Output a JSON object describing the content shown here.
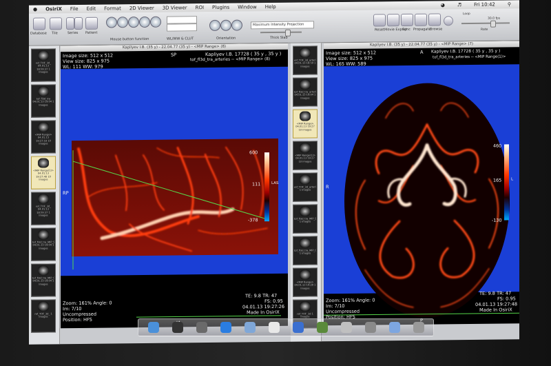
{
  "menubar": {
    "app": "OsiriX",
    "items": [
      "File",
      "Edit",
      "Format",
      "2D Viewer",
      "3D Viewer",
      "ROI",
      "Plugins",
      "Window",
      "Help"
    ],
    "clock": "Fri 10:42"
  },
  "toolbar": {
    "left_labels": [
      "Database",
      "Tile",
      "Series",
      "Patient",
      "Mouse button function",
      "WL/WW & CLUT",
      "Orientation",
      "Thick Slab"
    ],
    "right_labels": [
      "Reset",
      "Movie Export",
      "Sync",
      "Propagate",
      "Browse"
    ],
    "mode_text": "Maximum Intensity Projection",
    "loop_label": "Loop",
    "rate_label": "Rate",
    "fps": "30.0 fps"
  },
  "left_viewer": {
    "title": "Kapliyev I.B. (35 y) - 22.04.77 (35 y) - <MIP Range> (8)",
    "image_size": "Image size: 512 x 512",
    "view_size": "View size: 825 x 975",
    "wl_ww": "WL: 111 WW: 979",
    "orient_top": "SP",
    "orient_left": "RP",
    "orient_bottom": "IA",
    "patient": "Kapliyev I.B. 17728 ( 35 y , 35 y )",
    "protocol": "tof_fl3d_tra_arteries -- <MIP Range> (8)",
    "cb_max": "600",
    "cb_mid": "111",
    "cb_min": "-378",
    "cb_side": "LAS",
    "zoom": "Zoom: 161% Angle: 0",
    "im": "Im: 7/10",
    "compression": "Uncompressed",
    "position": "Position: HFS",
    "te_tr": "TE: 9.8 TR: 47",
    "fs": "FS: 0.95",
    "date": "04.01.13 19:27:26",
    "made_in": "Made In OsiriX"
  },
  "right_viewer": {
    "title": "Kapliyev I.B. (35 y) - 22.04.77 (35 y) - <MIP Range> (7)",
    "image_size": "Image size: 512 x 512",
    "view_size": "View size: 825 x 975",
    "wl_ww": "WL: 165 WW: 589",
    "orient_top": "A",
    "orient_left": "R",
    "orient_bottom": "P",
    "patient": "Kapliyev I.B. 17728 ( 35 y , 35 y )",
    "protocol": "tof_fl3d_tra_arteries -- <MIP Range(1)>",
    "cb_max": "460",
    "cb_mid": "165",
    "cb_min": "-130",
    "cb_side": "L",
    "zoom": "Zoom: 161% Angle: 0",
    "im": "Im: 7/10",
    "compression": "Uncompressed",
    "position": "Position: HFS",
    "te_tr": "TE: 9.8 TR: 47",
    "fs": "FS: 0.95",
    "date": "04.01.13 19:27:48",
    "made_in": "Made In OsiriX"
  },
  "left_series": [
    {
      "caption": "ref_TOF_3d_ 04.01.13 18:59:37 1 Images",
      "selected": false
    },
    {
      "caption": "tof_fl3d_tra 04.01.13 19:04 1 Images",
      "selected": false
    },
    {
      "caption": "<MIP Range> 04.01.13 19:27:18 10 Images",
      "selected": false
    },
    {
      "caption": "<MIP Range(1)> 04.01.13 19:27:48 10 Images",
      "selected": true
    },
    {
      "caption": "ref_TOF_3d_ 04.01.13 18:59:37 1 Images",
      "selected": false
    },
    {
      "caption": "tof_fl3d_tra_MIP_SAG 04.01.13 19:04 1 Images",
      "selected": false
    },
    {
      "caption": "tof_fl3d_tra_MIP_COR 04.01.13 19:04 1 Images",
      "selected": false
    },
    {
      "caption": "ref_TOF_3d_ 1 Images",
      "selected": false
    }
  ],
  "mid_series": [
    {
      "caption": "ref_TOF_3d_arteries 04.01.13 18:59 1 Images",
      "selected": false
    },
    {
      "caption": "tof_fl3d_tra_arteries 04.01.13 19:04 1 Images",
      "selected": false
    },
    {
      "caption": "<MIP Range> 04.01.13 19:27 10 Images",
      "selected": true
    },
    {
      "caption": "<MIP Range(1)> 04.01.13 19:27 10 Images",
      "selected": false
    },
    {
      "caption": "ref_TOF_3d_arteries 1 Images",
      "selected": false
    },
    {
      "caption": "tof_fl3d_tra_MIP_SAG 1 Images",
      "selected": false
    },
    {
      "caption": "tof_fl3d_tra_MIP_COR 1 Images",
      "selected": false
    },
    {
      "caption": "<MIP Range> 04.01.13 19:28 1 Images",
      "selected": false
    },
    {
      "caption": "ref_TOF_3d 1 Images",
      "selected": false
    }
  ],
  "dock_icons": [
    "finder-icon",
    "dashboard-icon",
    "launchpad-icon",
    "safari-icon",
    "mail-icon",
    "ical-icon",
    "itunes-icon",
    "iphoto-icon",
    "osirix-icon",
    "preferences-icon",
    "folder-icon",
    "trash-icon"
  ],
  "colors": {
    "viewer_blue": "#1a3fd6",
    "vessel_red": "#ff3a10",
    "scout_line": "#56d84a"
  }
}
